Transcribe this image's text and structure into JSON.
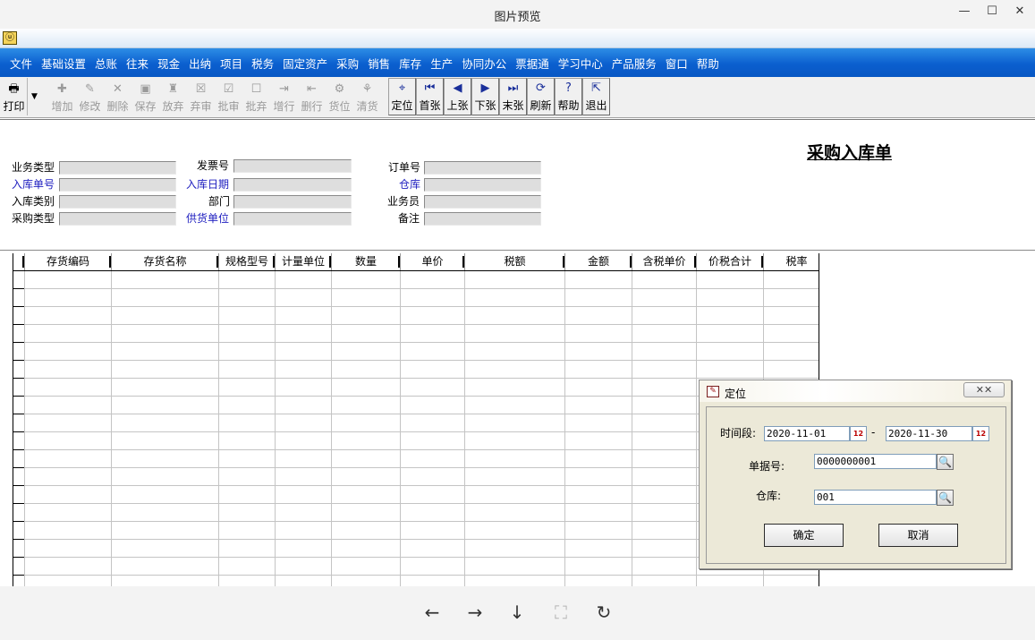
{
  "viewer": {
    "title": "图片预览",
    "win_min": "—",
    "win_max": "☐",
    "win_close": "✕",
    "controls": {
      "prev": "←",
      "next": "→",
      "download": "↓",
      "fit": "⛶",
      "rotate": "↻"
    }
  },
  "app": {
    "icon": "ⓤ",
    "menu": [
      "文件",
      "基础设置",
      "总账",
      "往来",
      "现金",
      "出纳",
      "项目",
      "税务",
      "固定资产",
      "采购",
      "销售",
      "库存",
      "生产",
      "协同办公",
      "票据通",
      "学习中心",
      "产品服务",
      "窗口",
      "帮助"
    ],
    "toolbar": {
      "print": {
        "label": "打印",
        "icon": "🖶"
      },
      "print_dropdown": "▼",
      "buttons": [
        {
          "label": "增加",
          "icon": "✚",
          "enabled": false
        },
        {
          "label": "修改",
          "icon": "✎",
          "enabled": false
        },
        {
          "label": "删除",
          "icon": "✕",
          "enabled": false
        },
        {
          "label": "保存",
          "icon": "▣",
          "enabled": false
        },
        {
          "label": "放弃",
          "icon": "♜",
          "enabled": false
        },
        {
          "label": "弃审",
          "icon": "☒",
          "enabled": false
        },
        {
          "label": "批审",
          "icon": "☑",
          "enabled": false
        },
        {
          "label": "批弃",
          "icon": "☐",
          "enabled": false
        },
        {
          "label": "增行",
          "icon": "⇥",
          "enabled": false
        },
        {
          "label": "删行",
          "icon": "⇤",
          "enabled": false
        },
        {
          "label": "货位",
          "icon": "⚙",
          "enabled": false
        },
        {
          "label": "清货",
          "icon": "⚘",
          "enabled": false
        },
        {
          "label": "定位",
          "icon": "⌖",
          "enabled": true
        },
        {
          "label": "首张",
          "icon": "⏮",
          "enabled": true
        },
        {
          "label": "上张",
          "icon": "◀",
          "enabled": true
        },
        {
          "label": "下张",
          "icon": "▶",
          "enabled": true
        },
        {
          "label": "末张",
          "icon": "⏭",
          "enabled": true
        },
        {
          "label": "刷新",
          "icon": "⟳",
          "enabled": true
        },
        {
          "label": "帮助",
          "icon": "?",
          "enabled": true
        },
        {
          "label": "退出",
          "icon": "⇱",
          "enabled": true
        }
      ]
    }
  },
  "form": {
    "title": "采购入库单",
    "fields": {
      "biz_type": "业务类型",
      "invoice_no": "发票号",
      "order_no": "订单号",
      "in_no": "入库单号",
      "in_date": "入库日期",
      "warehouse": "仓库",
      "in_type": "入库类别",
      "dept": "部门",
      "clerk": "业务员",
      "purchase_type": "采购类型",
      "supplier": "供货单位",
      "remark": "备注"
    }
  },
  "grid": {
    "columns": [
      "存货编码",
      "存货名称",
      "规格型号",
      "计量单位",
      "数量",
      "单价",
      "税额",
      "金额",
      "含税单价",
      "价税合计",
      "税率"
    ]
  },
  "dialog": {
    "title": "定位",
    "icon": "✎",
    "close": "✕✕",
    "period_label": "时间段:",
    "date_from": "2020-11-01",
    "date_sep": "-",
    "date_to": "2020-11-30",
    "cal_icon": "12",
    "doc_no_label": "单据号:",
    "doc_no": "0000000001",
    "warehouse_label": "仓库:",
    "warehouse": "001",
    "search_icon": "🔍",
    "ok": "确定",
    "cancel": "取消"
  }
}
